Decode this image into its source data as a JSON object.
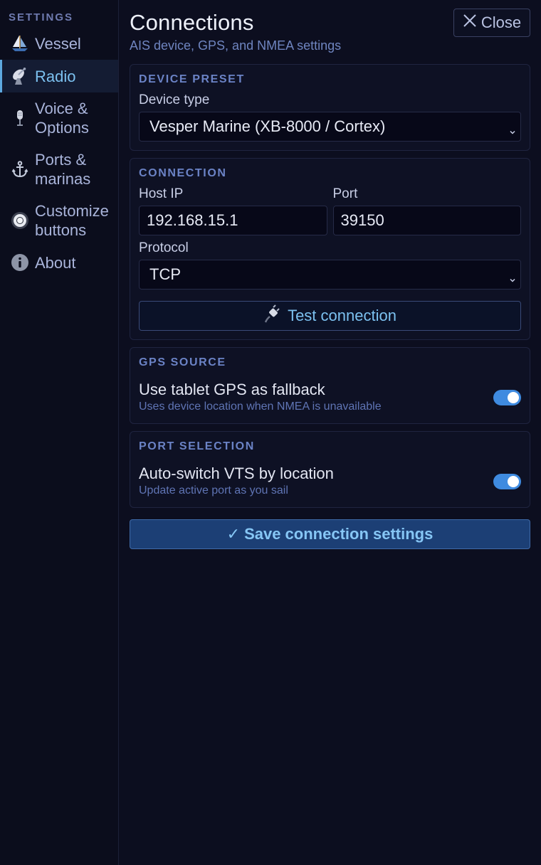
{
  "sidebar": {
    "heading": "SETTINGS",
    "items": [
      {
        "label": "Vessel",
        "icon": "sailboat-icon",
        "active": false
      },
      {
        "label": "Radio",
        "icon": "satellite-antenna-icon",
        "active": true
      },
      {
        "label_line1": "Voice &",
        "label_line2": "Options",
        "icon": "microphone-icon",
        "active": false
      },
      {
        "label_line1": "Ports &",
        "label_line2": "marinas",
        "icon": "anchor-icon",
        "active": false
      },
      {
        "label_line1": "Customize",
        "label_line2": "buttons",
        "icon": "radio-button-icon",
        "active": false
      },
      {
        "label": "About",
        "icon": "info-icon",
        "active": false
      }
    ]
  },
  "header": {
    "title": "Connections",
    "subtitle": "AIS device, GPS, and NMEA settings",
    "close_label": "Close"
  },
  "device_preset": {
    "heading": "DEVICE PRESET",
    "device_type_label": "Device type",
    "device_type_value": "Vesper Marine (XB-8000 / Cortex)"
  },
  "connection": {
    "heading": "CONNECTION",
    "host_label": "Host IP",
    "host_value": "192.168.15.1",
    "port_label": "Port",
    "port_value": "39150",
    "protocol_label": "Protocol",
    "protocol_value": "TCP",
    "test_label": "Test connection"
  },
  "gps_source": {
    "heading": "GPS SOURCE",
    "title": "Use tablet GPS as fallback",
    "description": "Uses device location when NMEA is unavailable",
    "enabled": true
  },
  "port_selection": {
    "heading": "PORT SELECTION",
    "title": "Auto-switch VTS by location",
    "description": "Update active port as you sail",
    "enabled": true
  },
  "save_label": "Save connection settings",
  "colors": {
    "background": "#0c0e1f",
    "accent": "#7cc1f0",
    "toggle_on": "#3f8be0",
    "save_bg": "#1c3f75"
  }
}
